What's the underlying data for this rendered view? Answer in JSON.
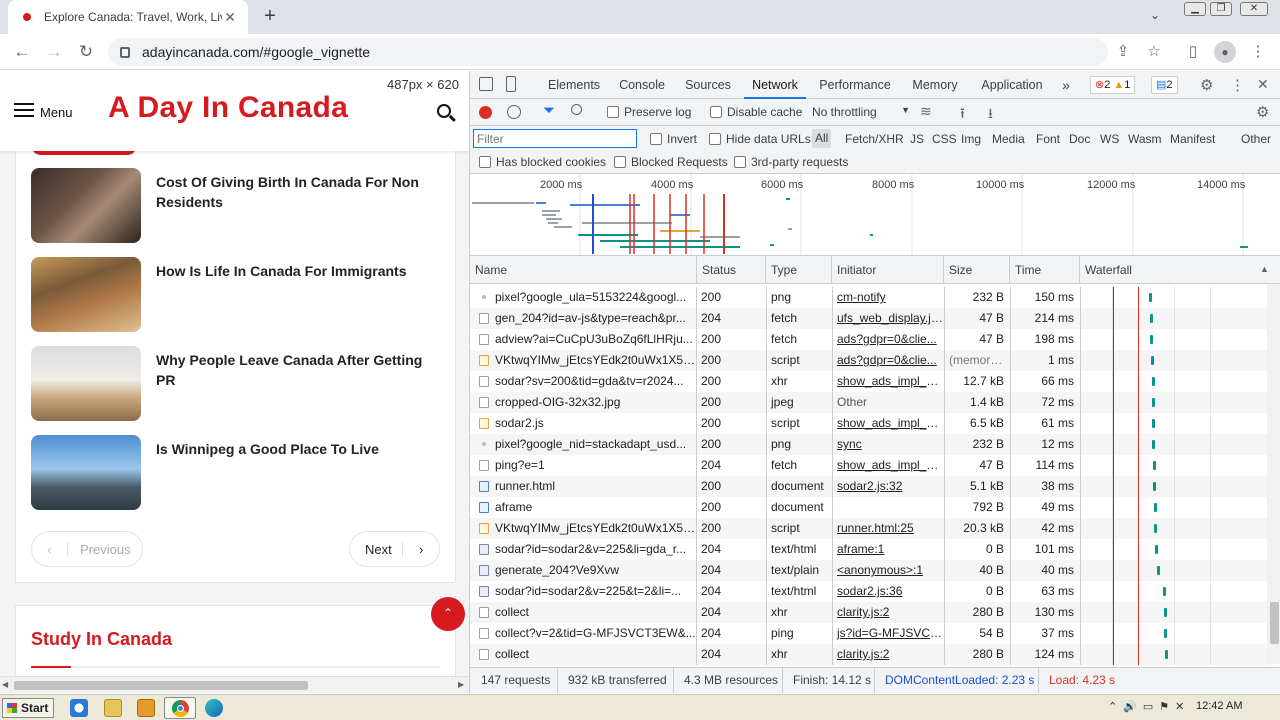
{
  "browser": {
    "tab_title": "Explore Canada: Travel, Work, Live,",
    "url": "adayincanada.com/#google_vignette"
  },
  "page": {
    "menu_label": "Menu",
    "logo": "A Day In Canada",
    "dimensions_tip": "487px × 620",
    "posts": [
      {
        "title": "Cost Of Giving Birth In Canada For Non Residents"
      },
      {
        "title": "How Is Life In Canada For Immigrants"
      },
      {
        "title": "Why People Leave Canada After Getting PR"
      },
      {
        "title": "Is Winnipeg a Good Place To Live"
      }
    ],
    "pager": {
      "previous": "Previous",
      "next": "Next"
    },
    "section_title": "Study In Canada"
  },
  "devtools": {
    "tabs": [
      "Elements",
      "Console",
      "Sources",
      "Network",
      "Performance",
      "Memory",
      "Application"
    ],
    "active_tab": "Network",
    "errors": "2",
    "warnings": "1",
    "messages": "2",
    "toolbar": {
      "preserve_log": "Preserve log",
      "disable_cache": "Disable cache",
      "throttling": "No throttling"
    },
    "filter": {
      "placeholder": "Filter",
      "invert": "Invert",
      "hide_data_urls": "Hide data URLs",
      "types": [
        "All",
        "Fetch/XHR",
        "JS",
        "CSS",
        "Img",
        "Media",
        "Font",
        "Doc",
        "WS",
        "Wasm",
        "Manifest",
        "Other"
      ],
      "has_blocked_cookies": "Has blocked cookies",
      "blocked_requests": "Blocked Requests",
      "third_party": "3rd-party requests"
    },
    "overview_ticks": [
      "2000 ms",
      "4000 ms",
      "6000 ms",
      "8000 ms",
      "10000 ms",
      "12000 ms",
      "14000 ms"
    ],
    "columns": [
      "Name",
      "Status",
      "Type",
      "Initiator",
      "Size",
      "Time",
      "Waterfall"
    ],
    "requests": [
      {
        "icon": "img",
        "name": "pixel?google_ula=5153224&googl...",
        "status": "200",
        "type": "png",
        "initiator": "cm-notify",
        "size": "232 B",
        "time": "150 ms",
        "bar": 0.137
      },
      {
        "icon": "blank",
        "name": "gen_204?id=av-js&type=reach&pr...",
        "status": "204",
        "type": "fetch",
        "initiator": "ufs_web_display.js...",
        "size": "47 B",
        "time": "214 ms",
        "bar": 0.139
      },
      {
        "icon": "blank",
        "name": "adview?ai=CuCpU3uBoZq6fLlHRju...",
        "status": "200",
        "type": "fetch",
        "initiator": "ads?gdpr=0&clie...",
        "size": "47 B",
        "time": "198 ms",
        "bar": 0.139
      },
      {
        "icon": "script",
        "name": "VKtwqYIMw_jEtcsYEdk2t0uWx1X5n...",
        "status": "200",
        "type": "script",
        "initiator": "ads?gdpr=0&clie...",
        "size": "(memory...",
        "time": "1 ms",
        "bar": 0.14
      },
      {
        "icon": "blank",
        "name": "sodar?sv=200&tid=gda&tv=r2024...",
        "status": "200",
        "type": "xhr",
        "initiator": "show_ads_impl_w...",
        "size": "12.7 kB",
        "time": "66 ms",
        "bar": 0.142
      },
      {
        "icon": "blank",
        "name": "cropped-OIG-32x32.jpg",
        "status": "200",
        "type": "jpeg",
        "initiator": "Other",
        "size": "1.4 kB",
        "time": "72 ms",
        "bar": 0.142
      },
      {
        "icon": "script",
        "name": "sodar2.js",
        "status": "200",
        "type": "script",
        "initiator": "show_ads_impl_w...",
        "size": "6.5 kB",
        "time": "61 ms",
        "bar": 0.143
      },
      {
        "icon": "img",
        "name": "pixel?google_nid=stackadapt_usd...",
        "status": "200",
        "type": "png",
        "initiator": "sync",
        "size": "232 B",
        "time": "12 ms",
        "bar": 0.143
      },
      {
        "icon": "blank",
        "name": "ping?e=1",
        "status": "204",
        "type": "fetch",
        "initiator": "show_ads_impl_w...",
        "size": "47 B",
        "time": "114 ms",
        "bar": 0.144
      },
      {
        "icon": "doc",
        "name": "runner.html",
        "status": "200",
        "type": "document",
        "initiator": "sodar2.js:32",
        "size": "5.1 kB",
        "time": "38 ms",
        "bar": 0.145
      },
      {
        "icon": "doc",
        "name": "aframe",
        "status": "200",
        "type": "document",
        "initiator": "",
        "size": "792 B",
        "time": "49 ms",
        "bar": 0.146
      },
      {
        "icon": "script",
        "name": "VKtwqYIMw_jEtcsYEdk2t0uWx1X5n...",
        "status": "200",
        "type": "script",
        "initiator": "runner.html:25",
        "size": "20.3 kB",
        "time": "42 ms",
        "bar": 0.147
      },
      {
        "icon": "text",
        "name": "sodar?id=sodar2&v=225&li=gda_r...",
        "status": "204",
        "type": "text/html",
        "initiator": "aframe:1",
        "size": "0 B",
        "time": "101 ms",
        "bar": 0.149
      },
      {
        "icon": "text",
        "name": "generate_204?Ve9Xvw",
        "status": "204",
        "type": "text/plain",
        "initiator": "<anonymous>:1",
        "size": "40 B",
        "time": "40 ms",
        "bar": 0.153
      },
      {
        "icon": "text",
        "name": "sodar?id=sodar2&v=225&t=2&li=...",
        "status": "204",
        "type": "text/html",
        "initiator": "sodar2.js:36",
        "size": "0 B",
        "time": "63 ms",
        "bar": 0.165
      },
      {
        "icon": "blank",
        "name": "collect",
        "status": "204",
        "type": "xhr",
        "initiator": "clarity.js:2",
        "size": "280 B",
        "time": "130 ms",
        "bar": 0.167
      },
      {
        "icon": "blank",
        "name": "collect?v=2&tid=G-MFJSVCT3EW&...",
        "status": "204",
        "type": "ping",
        "initiator": "js?id=G-MFJSVCT...",
        "size": "54 B",
        "time": "37 ms",
        "bar": 0.168
      },
      {
        "icon": "blank",
        "name": "collect",
        "status": "204",
        "type": "xhr",
        "initiator": "clarity.js:2",
        "size": "280 B",
        "time": "124 ms",
        "bar": 0.169
      }
    ],
    "status": {
      "requests": "147 requests",
      "transferred": "932 kB transferred",
      "resources": "4.3 MB resources",
      "finish": "Finish: 14.12 s",
      "dcl": "DOMContentLoaded: 2.23 s",
      "load": "Load: 4.23 s"
    }
  },
  "taskbar": {
    "start": "Start",
    "clock": "12:42 AM"
  },
  "colors": {
    "brand_red": "#d71920",
    "devtools_blue": "#1a73e8",
    "dcl_blue": "#1a4fd6",
    "load_red": "#d93025"
  }
}
